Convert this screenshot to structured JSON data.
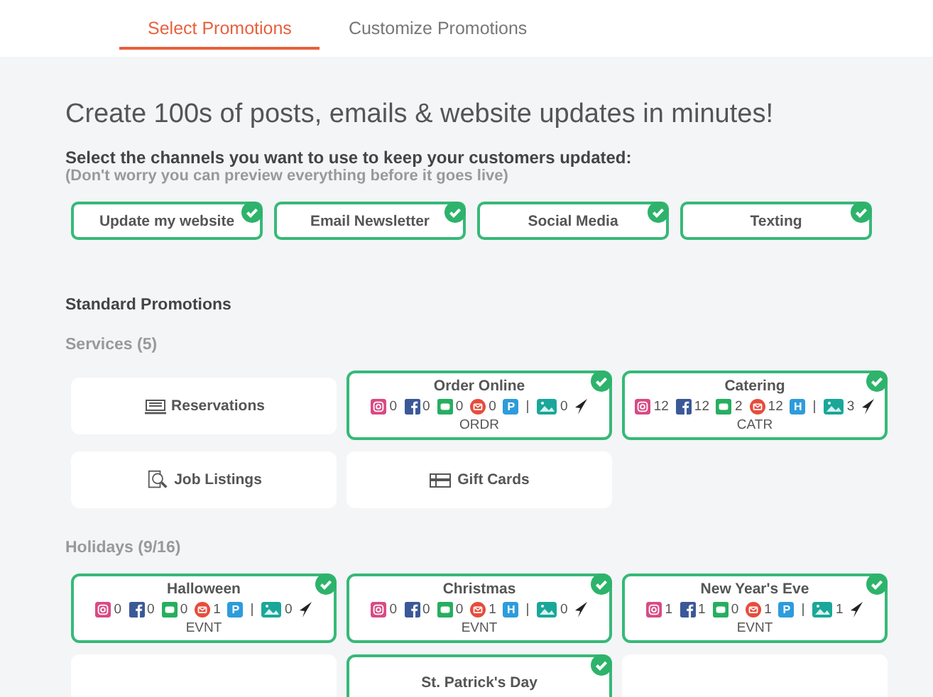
{
  "tabs": [
    {
      "label": "Select Promotions",
      "selected": true
    },
    {
      "label": "Customize Promotions",
      "selected": false
    }
  ],
  "headline": "Create 100s of posts, emails & website updates in minutes!",
  "channels_prompt": "Select the channels you want to use to keep your customers updated:",
  "channels_note": "(Don't worry you can preview everything before it goes live)",
  "channels": [
    {
      "label": "Update my website",
      "selected": true
    },
    {
      "label": "Email Newsletter",
      "selected": true
    },
    {
      "label": "Social Media",
      "selected": true
    },
    {
      "label": "Texting",
      "selected": true
    }
  ],
  "standard_heading": "Standard Promotions",
  "groups": [
    {
      "heading": "Services (5)",
      "promotions": [
        {
          "title": "Reservations",
          "selected": false,
          "kind": "reservations"
        },
        {
          "title": "Order Online",
          "selected": true,
          "stats": [
            "0",
            "0",
            "0",
            "0"
          ],
          "badge": "P",
          "images": "0",
          "tag": "ORDR"
        },
        {
          "title": "Catering",
          "selected": true,
          "stats": [
            "12",
            "12",
            "2",
            "12"
          ],
          "badge": "H",
          "images": "3",
          "tag": "CATR"
        },
        {
          "title": "Job Listings",
          "selected": false,
          "kind": "jobs"
        },
        {
          "title": "Gift Cards",
          "selected": false,
          "kind": "giftcard"
        }
      ]
    },
    {
      "heading": "Holidays (9/16)",
      "promotions": [
        {
          "title": "Halloween",
          "selected": true,
          "stats": [
            "0",
            "0",
            "0",
            "1"
          ],
          "badge": "P",
          "images": "0",
          "tag": "EVNT"
        },
        {
          "title": "Christmas",
          "selected": true,
          "stats": [
            "0",
            "0",
            "0",
            "1"
          ],
          "badge": "H",
          "images": "0",
          "tag": "EVNT"
        },
        {
          "title": "New Year's Eve",
          "selected": true,
          "stats": [
            "1",
            "1",
            "0",
            "1"
          ],
          "badge": "P",
          "images": "1",
          "tag": "EVNT"
        },
        {
          "selected": false
        },
        {
          "title": "St. Patrick's Day",
          "selected": true
        },
        {
          "selected": false
        }
      ]
    }
  ]
}
